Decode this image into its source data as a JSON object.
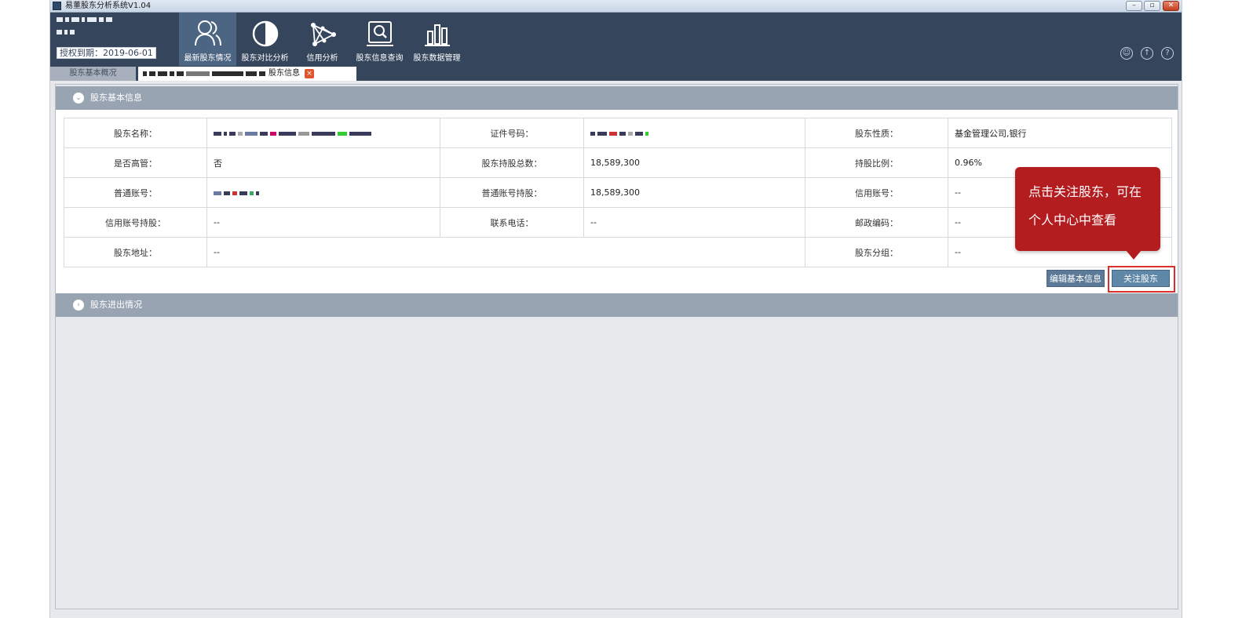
{
  "window": {
    "title": "易董股东分析系统V1.04",
    "controls": {
      "minimize": "–",
      "maximize": "▫",
      "close": "✕"
    }
  },
  "header": {
    "license": "授权到期：2019-06-01",
    "nav": [
      {
        "label": "最新股东情况",
        "icon": "people-icon",
        "active": true
      },
      {
        "label": "股东对比分析",
        "icon": "half-circle-icon",
        "active": false
      },
      {
        "label": "信用分析",
        "icon": "network-icon",
        "active": false
      },
      {
        "label": "股东信息查询",
        "icon": "search-monitor-icon",
        "active": false
      },
      {
        "label": "股东数据管理",
        "icon": "bar-chart-icon",
        "active": false
      }
    ],
    "right_icons": [
      "user-icon",
      "upload-icon",
      "help-icon"
    ],
    "right_icon_glyphs": {
      "user": "☺",
      "upload": "↑",
      "help": "?"
    }
  },
  "tabs": {
    "basic": "股东基本概况",
    "info": "股东信息",
    "close": "×"
  },
  "sections": {
    "basic_info": "股东基本信息",
    "inout": "股东进出情况",
    "chevron_open": "⌄",
    "chevron_closed": "›"
  },
  "info": {
    "labels": {
      "name": "股东名称：",
      "id_no": "证件号码：",
      "nature": "股东性质：",
      "executive": "是否高管：",
      "total_holding": "股东持股总数：",
      "ratio": "持股比例：",
      "normal_account": "普通账号：",
      "normal_holding": "普通账号持股：",
      "credit_account": "信用账号：",
      "credit_holding": "信用账号持股：",
      "phone": "联系电话：",
      "zipcode": "邮政编码：",
      "address": "股东地址：",
      "group": "股东分组："
    },
    "values": {
      "nature": "基金管理公司,银行",
      "executive": "否",
      "total_holding": "18,589,300",
      "ratio": "0.96%",
      "normal_holding": "18,589,300",
      "credit_account": "--",
      "credit_holding": "--",
      "phone": "--",
      "zipcode": "--",
      "address": "--",
      "group": "--"
    }
  },
  "buttons": {
    "edit": "编辑基本信息",
    "follow": "关注股东"
  },
  "tooltip": {
    "line1": "点击关注股东，可在",
    "line2": "个人中心中查看"
  }
}
